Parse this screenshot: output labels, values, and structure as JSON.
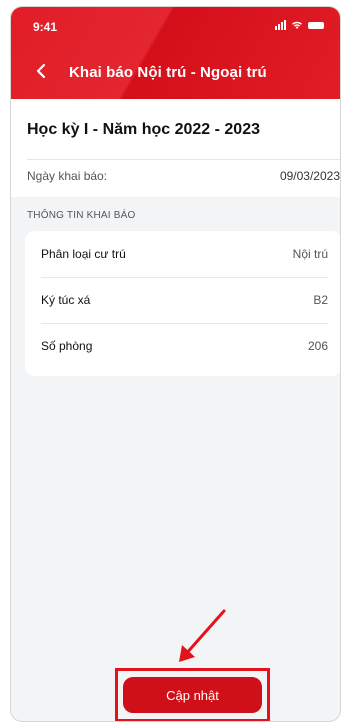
{
  "status_bar": {
    "time": "9:41"
  },
  "header": {
    "title": "Khai báo Nội trú - Ngoại trú"
  },
  "semester": "Học kỳ I - Năm học 2022  - 2023",
  "declaration_date": {
    "label": "Ngày khai báo:",
    "value": "09/03/2023"
  },
  "section_title": "THÔNG TIN KHAI BÁO",
  "info_rows": [
    {
      "label": "Phân loại cư trú",
      "value": "Nội trú"
    },
    {
      "label": "Ký túc xá",
      "value": "B2"
    },
    {
      "label": "Số phòng",
      "value": "206"
    }
  ],
  "update_button": {
    "label": "Cập nhật"
  },
  "colors": {
    "brand_red": "#e11d26",
    "button_red": "#cf1018",
    "highlight_red": "#e4121d"
  }
}
